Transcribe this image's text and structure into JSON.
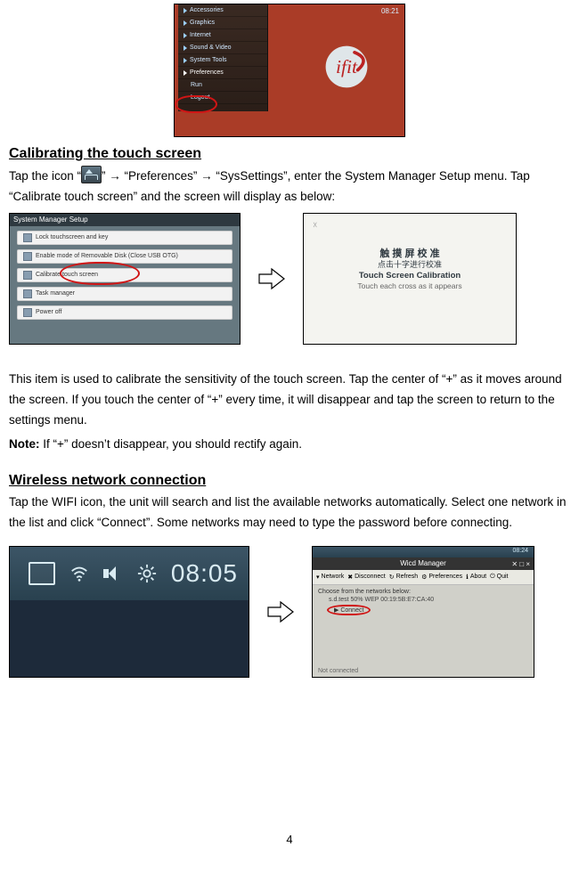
{
  "figure1": {
    "menu_items": [
      "Accessories",
      "Graphics",
      "Internet",
      "Sound & Video",
      "System Tools",
      "Preferences",
      "Run",
      "Logout"
    ],
    "logo_text": "ifit",
    "status_time": "08:21"
  },
  "section1": {
    "heading": "Calibrating the touch screen",
    "para_a": "Tap the icon “",
    "para_b": "” → “Preferences” → “SysSettings”, enter the System Manager Setup menu. Tap “Calibrate touch screen” and the screen will display as below:"
  },
  "figure2": {
    "window_title": "System Manager Setup",
    "items": [
      "Lock touchscreen and key",
      "Enable mode of Removable Disk (Close USB OTG)",
      "Calibrate touch screen",
      "Task manager",
      "Power off"
    ]
  },
  "figure3": {
    "cn_line1": "触 摸 屏 校 准",
    "cn_line2": "点击十字进行校准",
    "en_line1": "Touch Screen Calibration",
    "en_line2": "Touch each cross as it appears"
  },
  "section1b": {
    "para2": "This item is used to calibrate the sensitivity of the touch screen. Tap the center of “+” as it moves around the screen. If you touch the center of “+” every time, it will disappear and tap the screen to return to the settings menu.",
    "note_label": "Note:",
    "note_text": " If “+” doesn’t disappear, you should rectify again."
  },
  "section2": {
    "heading": "Wireless network connection",
    "para": "Tap the WIFI icon, the unit will search and list the available networks automatically. Select one network in the list and click “Connect”. Some networks may need to type the password before connecting."
  },
  "figure4": {
    "time": "08:05"
  },
  "figure5": {
    "title": "Wicd Manager",
    "toolbar": [
      "Network",
      "Disconnect",
      "Refresh",
      "Preferences",
      "About",
      "Quit"
    ],
    "prompt": "Choose from the networks below:",
    "net_line": "s.d.test  50%  WEP  00:19:5B:E7:CA:40",
    "connect_label": "Connect",
    "status": "Not connected",
    "clock": "08:24"
  },
  "page_number": "4"
}
